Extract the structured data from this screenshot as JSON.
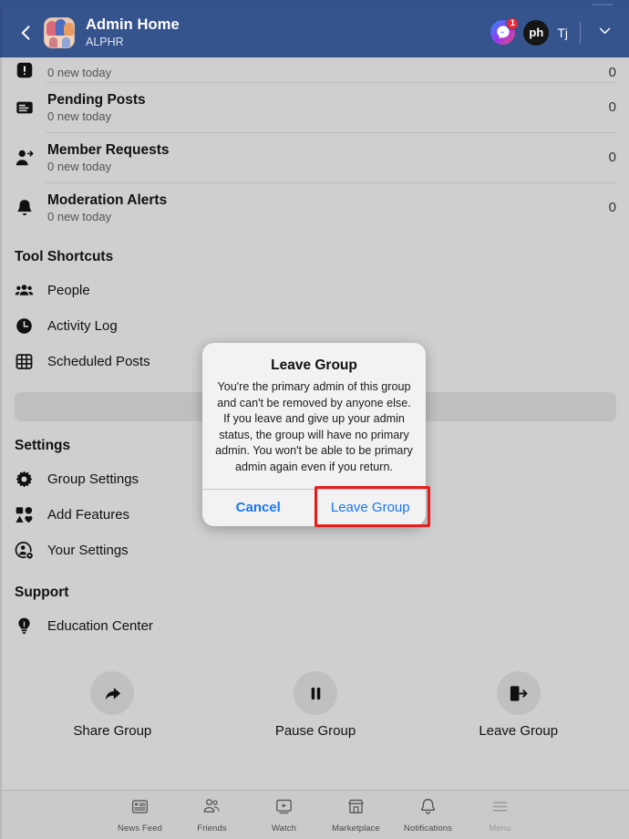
{
  "header": {
    "back_icon": "chevron-left-icon",
    "group_avatar_icon": "group-avatar-image",
    "title": "Admin Home",
    "subtitle": "ALPHR",
    "messenger_icon": "messenger-icon",
    "messenger_badge": "1",
    "user_avatar_text": "ph",
    "user_name": "Tj",
    "chevron_icon": "chevron-down-icon"
  },
  "alerts": [
    {
      "icon": "exclamation-box-icon",
      "title": "",
      "subtitle": "0 new today",
      "count": "0",
      "clipped": true
    },
    {
      "icon": "pending-posts-icon",
      "title": "Pending Posts",
      "subtitle": "0 new today",
      "count": "0",
      "clipped": false
    },
    {
      "icon": "member-requests-icon",
      "title": "Member Requests",
      "subtitle": "0 new today",
      "count": "0",
      "clipped": false
    },
    {
      "icon": "bell-icon",
      "title": "Moderation Alerts",
      "subtitle": "0 new today",
      "count": "0",
      "clipped": false
    }
  ],
  "tool_shortcuts": {
    "heading": "Tool Shortcuts",
    "items": [
      {
        "icon": "people-icon",
        "label": "People"
      },
      {
        "icon": "clock-icon",
        "label": "Activity Log"
      },
      {
        "icon": "calendar-grid-icon",
        "label": "Scheduled Posts"
      }
    ]
  },
  "settings": {
    "heading": "Settings",
    "items": [
      {
        "icon": "gear-icon",
        "label": "Group Settings"
      },
      {
        "icon": "shapes-icon",
        "label": "Add Features"
      },
      {
        "icon": "person-gear-icon",
        "label": "Your Settings"
      }
    ]
  },
  "support": {
    "heading": "Support",
    "items": [
      {
        "icon": "lightbulb-icon",
        "label": "Education Center"
      }
    ]
  },
  "actions": [
    {
      "icon": "share-arrow-icon",
      "label": "Share Group"
    },
    {
      "icon": "pause-icon",
      "label": "Pause Group"
    },
    {
      "icon": "exit-door-icon",
      "label": "Leave Group"
    }
  ],
  "bottom_nav": [
    {
      "icon": "news-feed-icon",
      "label": "News Feed",
      "dim": false
    },
    {
      "icon": "friends-icon",
      "label": "Friends",
      "dim": false
    },
    {
      "icon": "watch-icon",
      "label": "Watch",
      "dim": false
    },
    {
      "icon": "marketplace-icon",
      "label": "Marketplace",
      "dim": false
    },
    {
      "icon": "notifications-bell-icon",
      "label": "Notifications",
      "dim": false
    },
    {
      "icon": "hamburger-menu-icon",
      "label": "Menu",
      "dim": true
    }
  ],
  "modal": {
    "title": "Leave Group",
    "text": "You're the primary admin of this group and can't be removed by anyone else. If you leave and give up your admin status, the group will have no primary admin. You won't be able to be primary admin again even if you return.",
    "cancel_label": "Cancel",
    "confirm_label": "Leave Group"
  },
  "colors": {
    "header_blue": "#35538c",
    "page_background": "#cfcfcf",
    "link_blue": "#1877f2",
    "highlight_red": "#e81c1c",
    "badge_red": "#e8283c"
  }
}
